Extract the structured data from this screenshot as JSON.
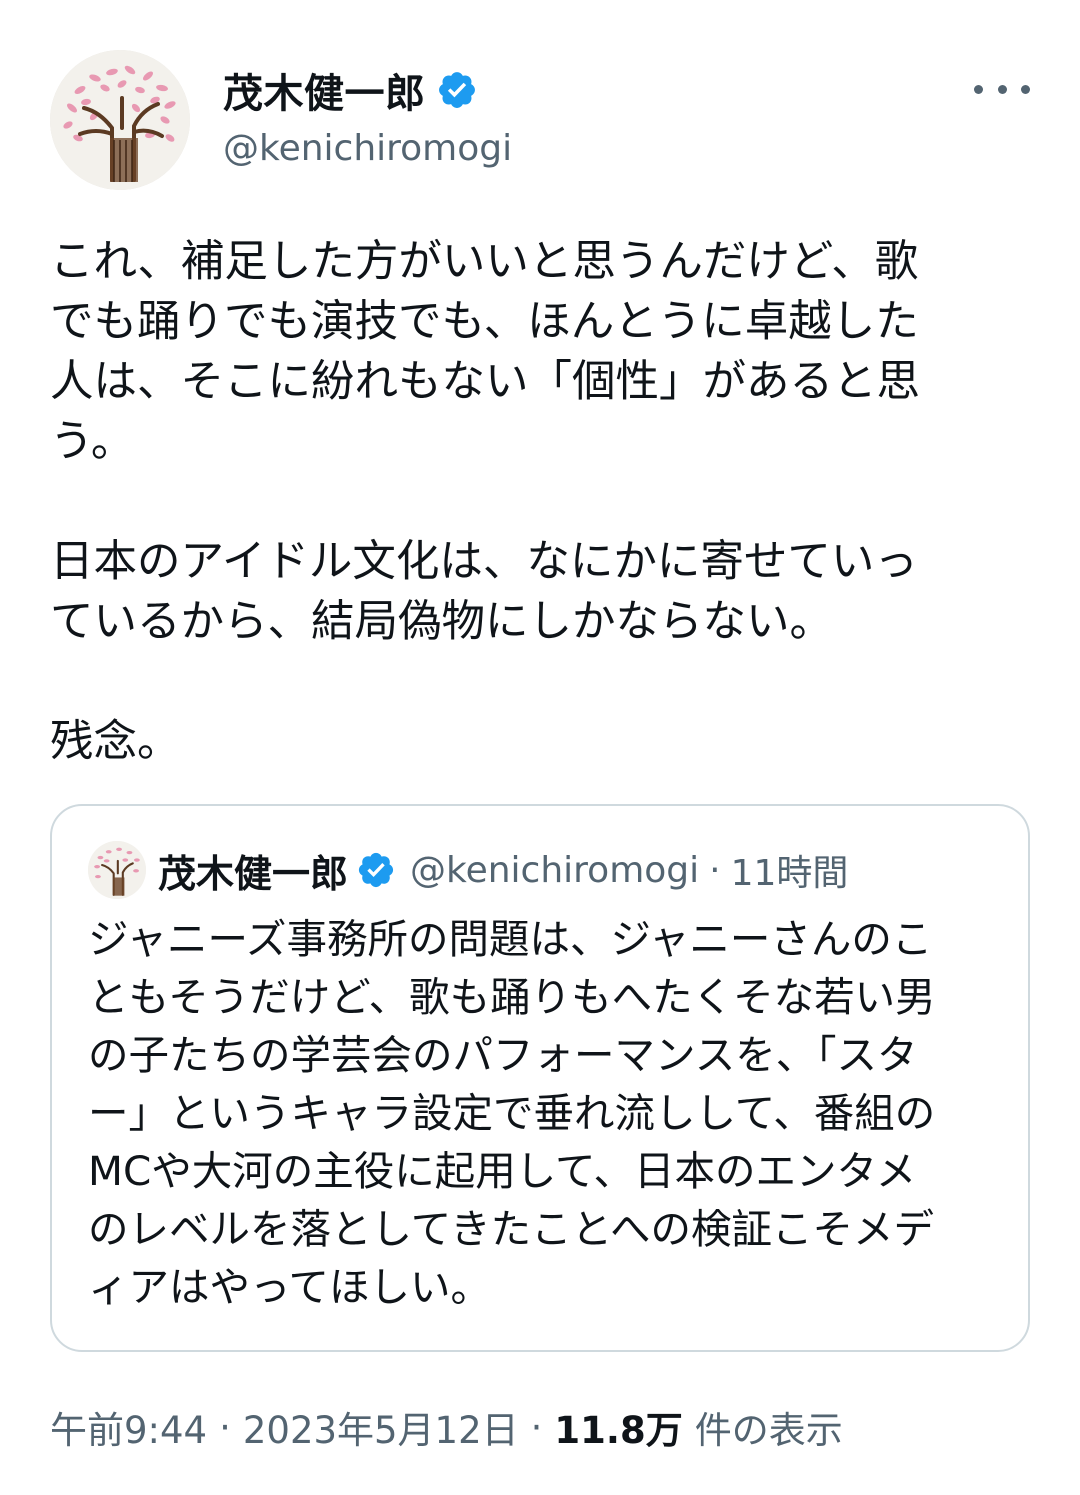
{
  "author": {
    "display_name": "茂木健一郎",
    "handle": "@kenichiromogi",
    "verified_color": "#1d9bf0",
    "avatar_icon": "cherry-tree-drawing-icon"
  },
  "more_icon": "more-horizontal-icon",
  "tweet": {
    "text": "これ、補足した方がいいと思うんだけど、歌\nでも踊りでも演技でも、ほんとうに卓越した\n人は、そこに紛れもない「個性」があると思\nう。\n\n日本のアイドル文化は、なにかに寄せていっ\nているから、結局偽物にしかならない。\n\n残念。"
  },
  "quoted_tweet": {
    "display_name": "茂木健一郎",
    "handle": "@kenichiromogi",
    "separator": "·",
    "time": "11時間",
    "text": "ジャニーズ事務所の問題は、ジャニーさんのこ\nともそうだけど、歌も踊りもへたくそな若い男\nの子たちの学芸会のパフォーマンスを、「スタ\nー」というキャラ設定で垂れ流しして、番組の\nMCや大河の主役に起用して、日本のエンタメ\nのレベルを落としてきたことへの検証こそメデ\nィアはやってほしい。"
  },
  "meta": {
    "time": "午前9:44",
    "date": "2023年5月12日",
    "separator": "·",
    "views_count": "11.8万",
    "views_label": "件の表示"
  }
}
